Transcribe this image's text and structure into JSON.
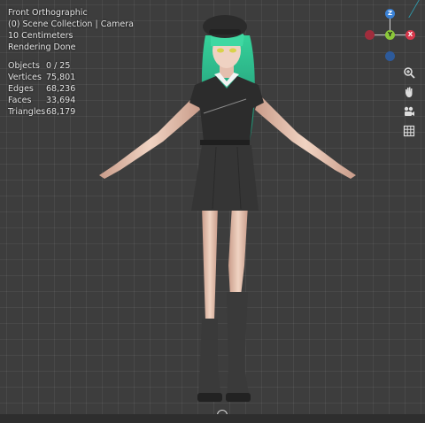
{
  "viewport": {
    "view_name": "Front Orthographic",
    "collection": "(0) Scene Collection | Camera",
    "scale": "10 Centimeters",
    "status": "Rendering Done",
    "stats": [
      {
        "label": "Objects",
        "value": "0 / 25"
      },
      {
        "label": "Vertices",
        "value": "75,801"
      },
      {
        "label": "Edges",
        "value": "68,236"
      },
      {
        "label": "Faces",
        "value": "33,694"
      },
      {
        "label": "Triangles",
        "value": "68,179"
      }
    ]
  },
  "gizmo": {
    "z": "Z",
    "y": "Y",
    "x": "X",
    "colors": {
      "x": "#d6384c",
      "y": "#8bc83a",
      "z": "#3b82d6",
      "neg_x": "#a02d3c",
      "neg_y": "#5c8a2a",
      "neg_z": "#2d5a9a"
    }
  },
  "tools": [
    "zoom-icon",
    "hand-pan-icon",
    "camera-icon",
    "grid-icon"
  ],
  "colors": {
    "background": "#3d3d3d",
    "hair": "#2fb890",
    "outfit": "#2a2a2a",
    "skin": "#e8c4b0"
  }
}
